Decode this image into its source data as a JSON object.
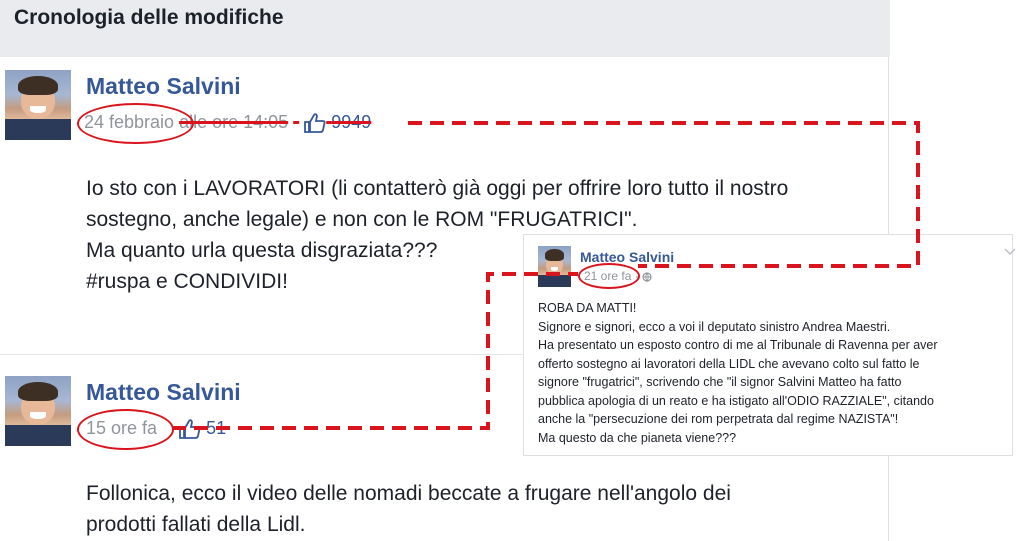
{
  "header": {
    "title": "Cronologia delle modifiche"
  },
  "post1": {
    "author": "Matteo Salvini",
    "date": "24 febbraio",
    "time": "alle ore 14:05",
    "sep": "·",
    "likes": "9949",
    "lines": [
      "Io sto con i LAVORATORI (li contatterò già oggi per offrire loro tutto il nostro",
      "sostegno, anche legale) e non con le ROM \"FRUGATRICI\".",
      "Ma quanto urla questa disgraziata???",
      "#ruspa e CONDIVIDI!"
    ]
  },
  "post2": {
    "author": "Matteo Salvini",
    "time": "15 ore fa",
    "likes": "51",
    "lines": [
      "Follonica, ecco il video delle nomadi beccate a frugare nell'angolo dei",
      "prodotti fallati della Lidl."
    ]
  },
  "inset_post": {
    "author": "Matteo Salvini",
    "time": "21 ore fa",
    "sep": "·",
    "lines": [
      "ROBA DA MATTI!",
      "Signore e signori, ecco a voi il deputato sinistro Andrea Maestri.",
      "Ha presentato un esposto contro di me al Tribunale di Ravenna per aver",
      "offerto sostegno ai lavoratori della LIDL che avevano colto sul fatto le",
      "signore \"frugatrici\", scrivendo che \"il signor Salvini Matteo ha fatto",
      "pubblica apologia di un reato e ha istigato all'ODIO RAZZIALE\", citando",
      "anche la \"persecuzione dei rom perpetrata dal regime NAZISTA\"!",
      "Ma questo da che pianeta viene???"
    ]
  },
  "colors": {
    "accent_red": "#d9141c",
    "link_blue": "#365899",
    "meta_gray": "#90949c"
  },
  "icons": {
    "like": "thumbs-up-icon",
    "globe": "globe-icon",
    "chevron": "chevron-down-icon"
  }
}
